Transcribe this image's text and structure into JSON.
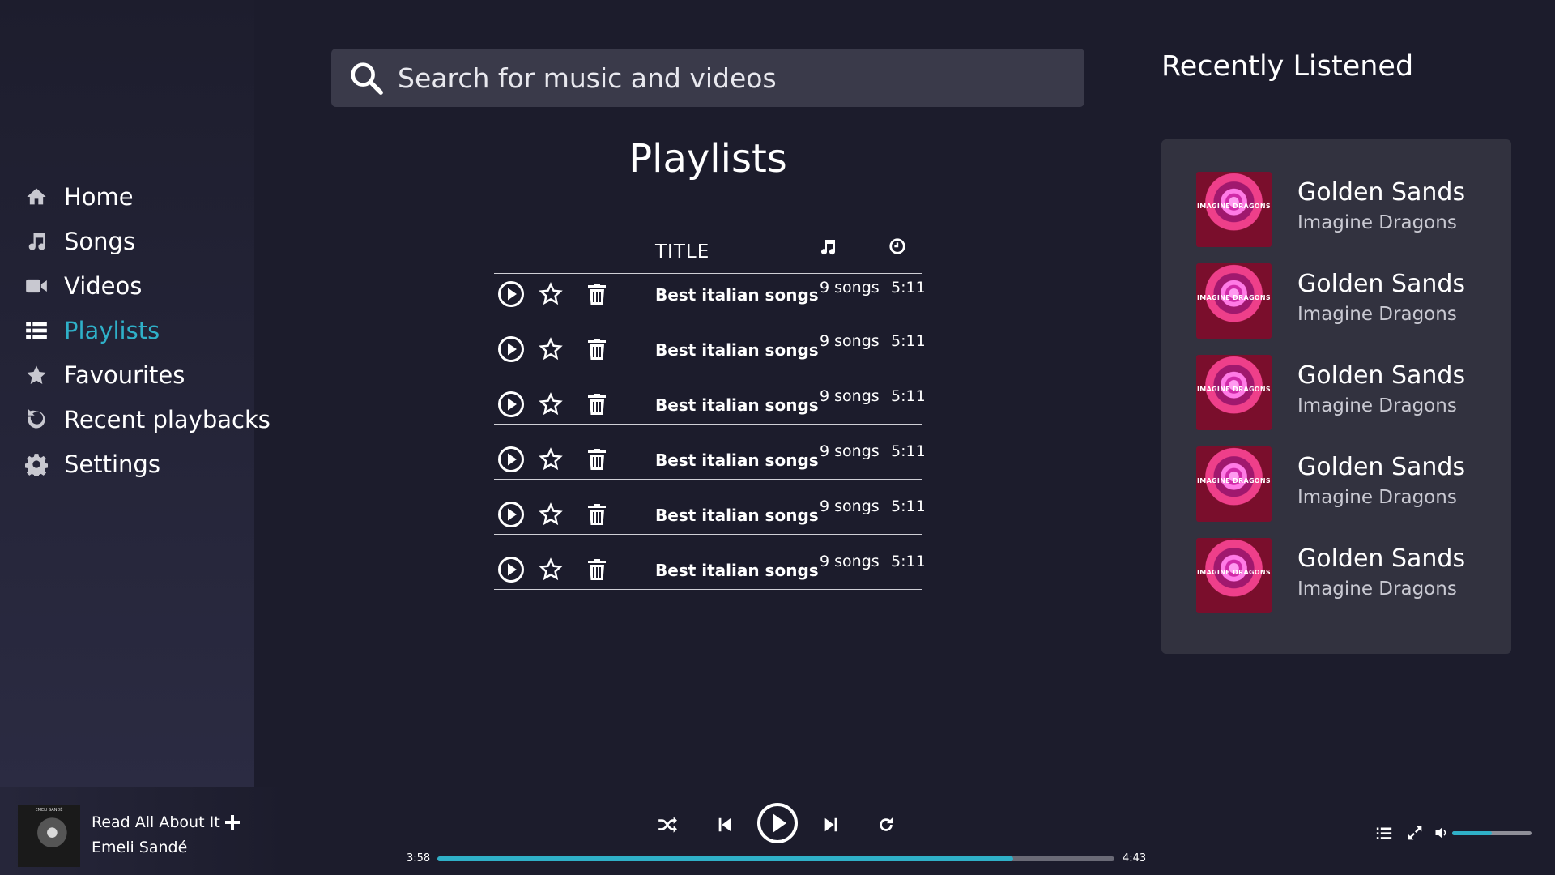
{
  "sidebar": {
    "items": [
      {
        "label": "Home",
        "icon": "home-icon"
      },
      {
        "label": "Songs",
        "icon": "music-note-icon"
      },
      {
        "label": "Videos",
        "icon": "video-camera-icon"
      },
      {
        "label": "Playlists",
        "icon": "list-icon",
        "active": true
      },
      {
        "label": "Favourites",
        "icon": "star-icon"
      },
      {
        "label": "Recent playbacks",
        "icon": "history-icon"
      },
      {
        "label": "Settings",
        "icon": "gear-icon"
      }
    ]
  },
  "search": {
    "placeholder": "Search for music and videos"
  },
  "main": {
    "title": "Playlists",
    "columns": {
      "title": "TITLE",
      "songs_icon": "music-note-icon",
      "duration_icon": "clock-icon"
    },
    "rows": [
      {
        "title": "Best italian songs",
        "count": "9 songs",
        "duration": "5:11"
      },
      {
        "title": "Best italian songs",
        "count": "9 songs",
        "duration": "5:11"
      },
      {
        "title": "Best italian songs",
        "count": "9 songs",
        "duration": "5:11"
      },
      {
        "title": "Best italian songs",
        "count": "9 songs",
        "duration": "5:11"
      },
      {
        "title": "Best italian songs",
        "count": "9 songs",
        "duration": "5:11"
      },
      {
        "title": "Best italian songs",
        "count": "9 songs",
        "duration": "5:11"
      }
    ]
  },
  "recent": {
    "title": "Recently Listened",
    "items": [
      {
        "title": "Golden Sands",
        "artist": "Imagine Dragons",
        "cover_text": "IMAGINE DRAGONS"
      },
      {
        "title": "Golden Sands",
        "artist": "Imagine Dragons",
        "cover_text": "IMAGINE DRAGONS"
      },
      {
        "title": "Golden Sands",
        "artist": "Imagine Dragons",
        "cover_text": "IMAGINE DRAGONS"
      },
      {
        "title": "Golden Sands",
        "artist": "Imagine Dragons",
        "cover_text": "IMAGINE DRAGONS"
      },
      {
        "title": "Golden Sands",
        "artist": "Imagine Dragons",
        "cover_text": "IMAGINE DRAGONS"
      }
    ]
  },
  "player": {
    "title": "Read All About It",
    "artist": "Emeli Sandé",
    "cover_text": "EMELI SANDÉ",
    "elapsed": "3:58",
    "total": "4:43",
    "progress": 0.85,
    "volume": 0.5
  },
  "colors": {
    "accent": "#2fb0c8",
    "background": "#1c1c2c",
    "panel": "#32323f",
    "search": "#3a3a4a"
  }
}
